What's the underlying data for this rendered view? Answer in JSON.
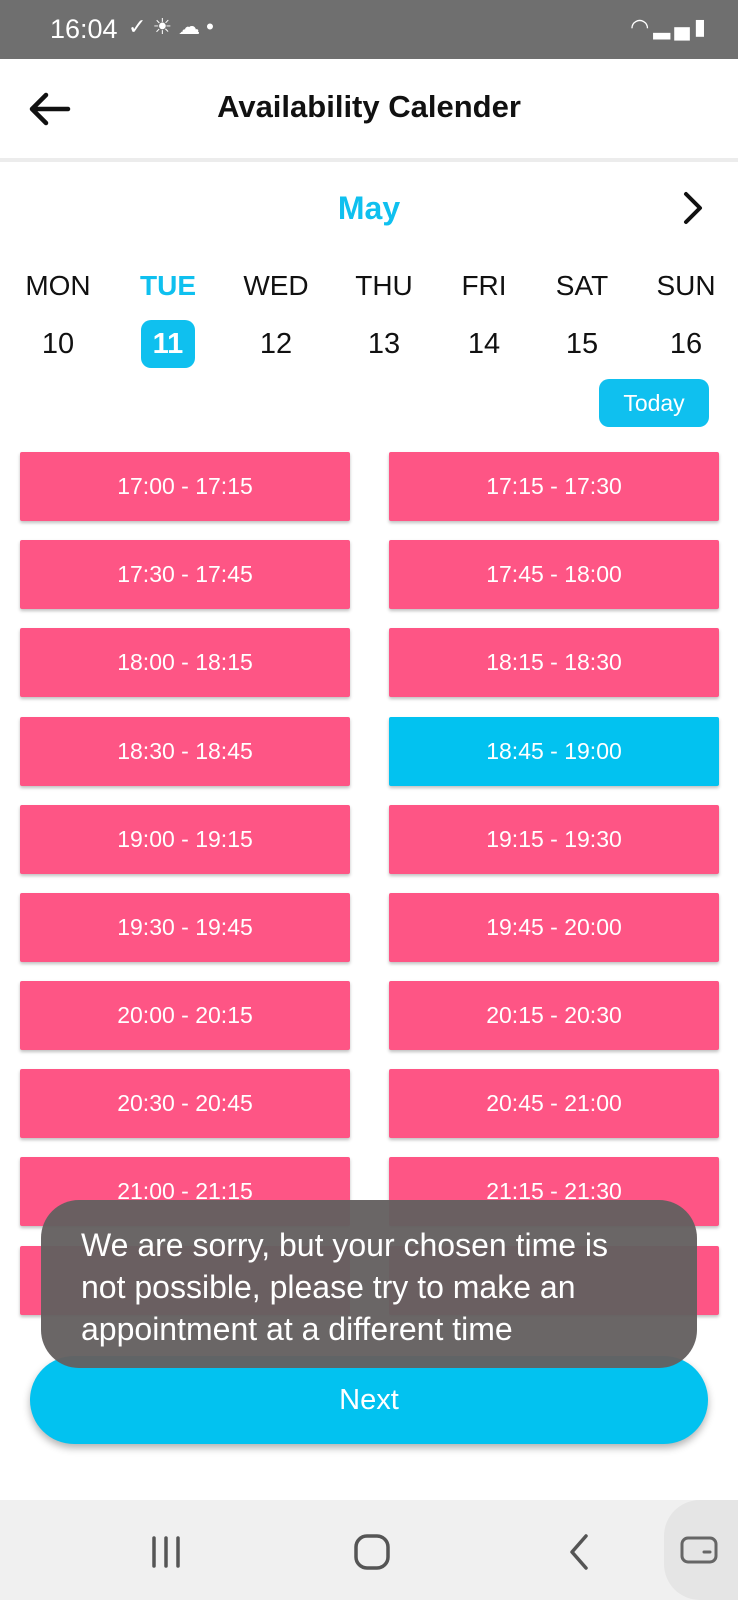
{
  "status": {
    "time": "16:04",
    "left_icons": [
      "check-icon",
      "sunrise-icon",
      "cloud-icon",
      "dot-icon"
    ],
    "right_icons": [
      "wifi-icon",
      "signal-icon",
      "battery-icon"
    ]
  },
  "header": {
    "title": "Availability Calender"
  },
  "calendar": {
    "month": "May",
    "days": [
      {
        "name": "MON",
        "num": "10"
      },
      {
        "name": "TUE",
        "num": "11",
        "selected": true
      },
      {
        "name": "WED",
        "num": "12"
      },
      {
        "name": "THU",
        "num": "13"
      },
      {
        "name": "FRI",
        "num": "14"
      },
      {
        "name": "SAT",
        "num": "15"
      },
      {
        "name": "SUN",
        "num": "16"
      }
    ],
    "today_label": "Today"
  },
  "slots": [
    "17:00 - 17:15",
    "17:15 - 17:30",
    "17:30 - 17:45",
    "17:45 - 18:00",
    "18:00 - 18:15",
    "18:15 - 18:30",
    "18:30 - 18:45",
    "18:45 - 19:00",
    "19:00 - 19:15",
    "19:15 - 19:30",
    "19:30 - 19:45",
    "19:45 - 20:00",
    "20:00 - 20:15",
    "20:15 - 20:30",
    "20:30 - 20:45",
    "20:45 - 21:00",
    "21:00 - 21:15",
    "21:15 - 21:30"
  ],
  "selected_slot": "18:45 - 19:00",
  "colors": {
    "accent": "#0fc0ef",
    "slot": "#fe5585",
    "selected_slot": "#02c2f0"
  },
  "next_label": "Next",
  "toast": "We are sorry, but your chosen time is not possible, please try to make an appointment at a different time"
}
